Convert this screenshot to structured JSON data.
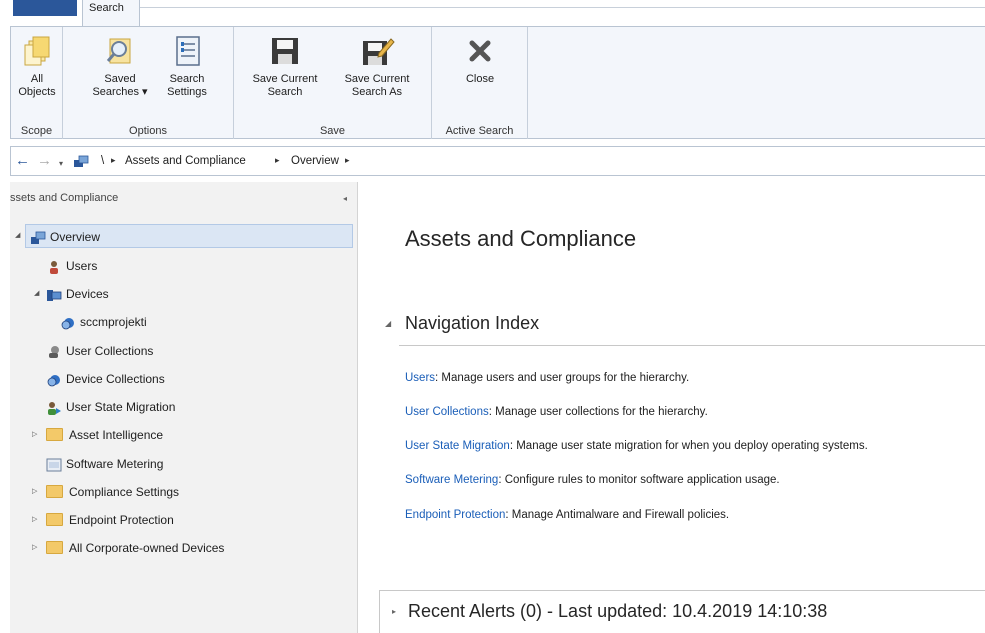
{
  "ribbon": {
    "tab_label": "Search",
    "groups": {
      "scope": "Scope",
      "options": "Options",
      "save": "Save",
      "active_search": "Active Search"
    },
    "buttons": {
      "all_objects_l1": "All",
      "all_objects_l2": "Objects",
      "saved_searches_l1": "Saved",
      "saved_searches_l2": "Searches ▾",
      "search_settings_l1": "Search",
      "search_settings_l2": "Settings",
      "save_current_l1": "Save Current",
      "save_current_l2": "Search",
      "save_current_as_l1": "Save Current",
      "save_current_as_l2": "Search As",
      "close": "Close"
    }
  },
  "address_bar": {
    "root": "\\",
    "crumbs": [
      "Assets and Compliance",
      "Overview"
    ]
  },
  "left_pane": {
    "title": "ssets and Compliance",
    "tree": [
      {
        "label": "Overview",
        "icon": "overview-icon"
      },
      {
        "label": "Users",
        "icon": "user-icon"
      },
      {
        "label": "Devices",
        "icon": "devices-icon"
      },
      {
        "label": "sccmprojekti",
        "icon": "collection-icon"
      },
      {
        "label": "User Collections",
        "icon": "user-collection-icon"
      },
      {
        "label": "Device Collections",
        "icon": "device-collection-icon"
      },
      {
        "label": "User State Migration",
        "icon": "migration-icon"
      },
      {
        "label": "Asset Intelligence",
        "icon": "folder-icon"
      },
      {
        "label": "Software Metering",
        "icon": "metering-icon"
      },
      {
        "label": "Compliance Settings",
        "icon": "folder-icon"
      },
      {
        "label": "Endpoint Protection",
        "icon": "folder-icon"
      },
      {
        "label": "All Corporate-owned Devices",
        "icon": "folder-icon"
      }
    ]
  },
  "main": {
    "title": "Assets and Compliance",
    "nav_index_title": "Navigation Index",
    "nav_items": [
      {
        "link": "Users",
        "text": ": Manage users and user groups for the hierarchy."
      },
      {
        "link": "User Collections",
        "text": ": Manage user collections for the hierarchy."
      },
      {
        "link": "User State Migration",
        "text": ": Manage user state migration for when you deploy operating systems."
      },
      {
        "link": "Software Metering",
        "text": ": Configure rules to monitor software application usage."
      },
      {
        "link": "Endpoint Protection",
        "text": ": Manage Antimalware and Firewall policies."
      }
    ],
    "recent_alerts": "Recent Alerts (0) - Last updated: 10.4.2019 14:10:38"
  },
  "colors": {
    "accent_blue": "#2b579a",
    "link": "#1a5eb8",
    "selection": "#dbe6f4",
    "ribbon_bg": "#f3f6fb"
  }
}
